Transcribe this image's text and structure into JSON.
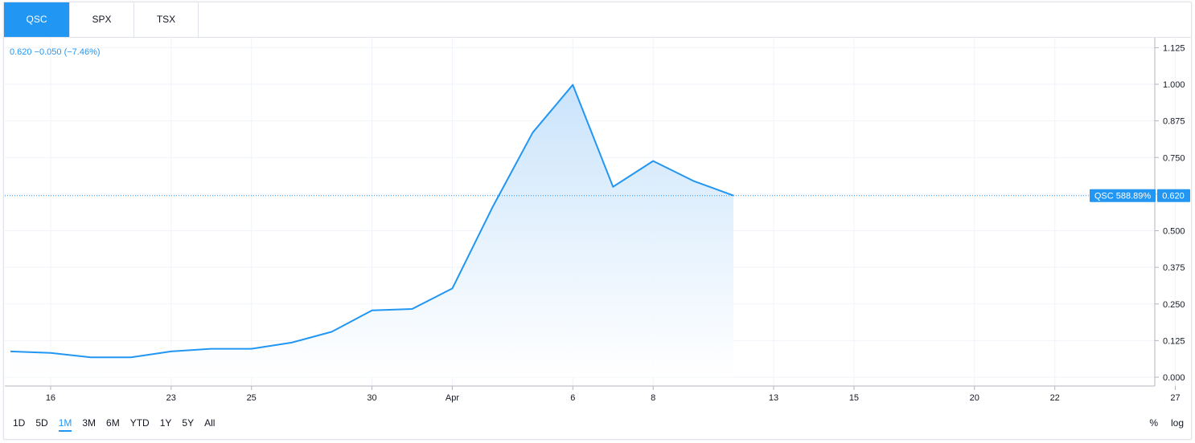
{
  "tabs": [
    {
      "label": "QSC",
      "active": true
    },
    {
      "label": "SPX",
      "active": false
    },
    {
      "label": "TSX",
      "active": false
    }
  ],
  "legend": {
    "text": "0.620 −0.050 (−7.46%)"
  },
  "price_tag": {
    "label": "QSC 588.89%",
    "value": "0.620"
  },
  "ranges": [
    {
      "label": "1D",
      "active": false
    },
    {
      "label": "5D",
      "active": false
    },
    {
      "label": "1M",
      "active": true
    },
    {
      "label": "3M",
      "active": false
    },
    {
      "label": "6M",
      "active": false
    },
    {
      "label": "YTD",
      "active": false
    },
    {
      "label": "1Y",
      "active": false
    },
    {
      "label": "5Y",
      "active": false
    },
    {
      "label": "All",
      "active": false
    }
  ],
  "scale_options": [
    "%",
    "log"
  ],
  "colors": {
    "accent": "#2196f3",
    "grid": "#f0f3fa",
    "fill_top": "#c7e2fb",
    "fill_bottom": "#ffffff"
  },
  "chart_data": {
    "type": "area",
    "x_ticks": [
      "16",
      "23",
      "25",
      "30",
      "Apr",
      "6",
      "8",
      "13",
      "15",
      "20",
      "22",
      "27"
    ],
    "x_tick_index": [
      1,
      4,
      6,
      9,
      11,
      14,
      16,
      19,
      21,
      24,
      26,
      29
    ],
    "y_ticks": [
      "0.000",
      "0.125",
      "0.250",
      "0.375",
      "0.500",
      "0.625",
      "0.750",
      "0.875",
      "1.000",
      "1.125"
    ],
    "ylim": [
      0,
      1.125
    ],
    "series": [
      {
        "points": [
          [
            0,
            0.088
          ],
          [
            1,
            0.083
          ],
          [
            2,
            0.068
          ],
          [
            3,
            0.068
          ],
          [
            4,
            0.088
          ],
          [
            5,
            0.097
          ],
          [
            6,
            0.097
          ],
          [
            7,
            0.118
          ],
          [
            8,
            0.155
          ],
          [
            9,
            0.228
          ],
          [
            10,
            0.233
          ],
          [
            11,
            0.303
          ],
          [
            12,
            0.58
          ],
          [
            13,
            0.835
          ],
          [
            14,
            0.998
          ],
          [
            15,
            0.65
          ],
          [
            16,
            0.738
          ],
          [
            17,
            0.67
          ],
          [
            18,
            0.62
          ]
        ]
      }
    ],
    "last_value": 0.62,
    "grid": true
  }
}
